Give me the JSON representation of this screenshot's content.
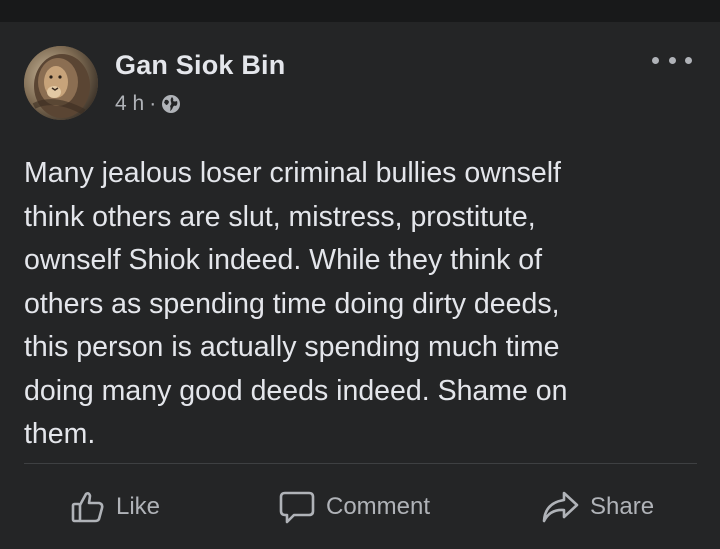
{
  "post": {
    "author": "Gan Siok Bin",
    "time": "4 h",
    "separator": "·",
    "visibility_icon": "globe-icon",
    "body": "Many jealous loser criminal bullies  ownself\nthink others are slut, mistress, prostitute,\nownself Shiok indeed. While they think of\nothers as spending time doing dirty deeds,\nthis person is actually spending much time\ndoing many good deeds indeed. Shame on\nthem."
  },
  "actions": {
    "like_label": "Like",
    "comment_label": "Comment",
    "share_label": "Share"
  },
  "icons": {
    "more": "more-options-icon",
    "like": "thumbs-up-icon",
    "comment": "comment-bubble-icon",
    "share": "share-arrow-icon"
  },
  "colors": {
    "background": "#18191a",
    "card": "#242526",
    "primary_text": "#e4e6eb",
    "secondary_text": "#b0b3b8"
  }
}
